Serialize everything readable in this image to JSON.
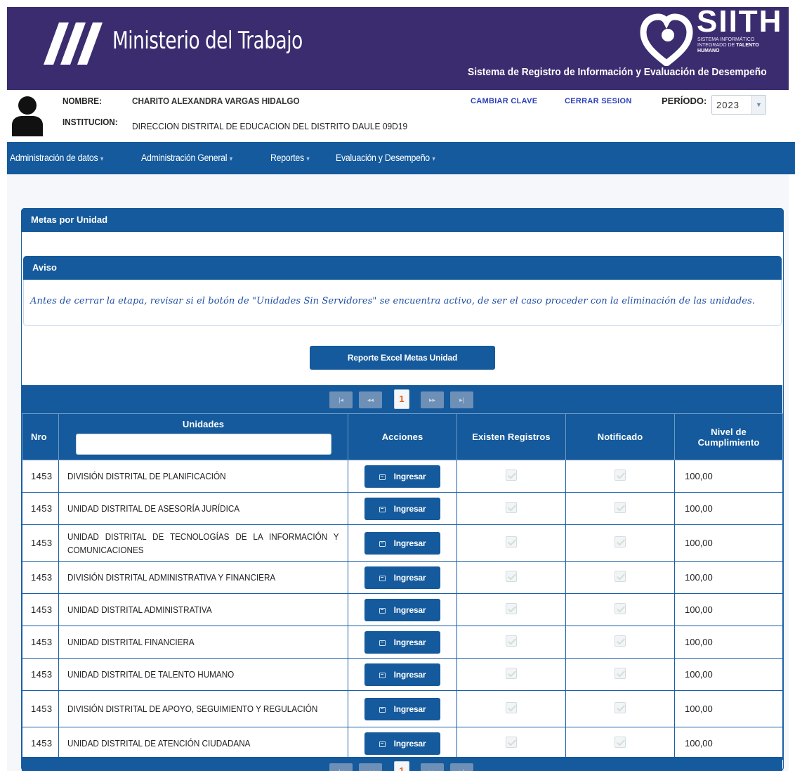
{
  "header": {
    "ministry": "Ministerio del Trabajo",
    "brand": "SIITH",
    "brand_sub_1": "SISTEMA INFORMÁTICO",
    "brand_sub_2": "INTEGRADO DE",
    "brand_sub_3": "TALENTO",
    "brand_sub_4": "HUMANO",
    "system_title": "Sistema de Registro de Información y Evaluación de Desempeño"
  },
  "user": {
    "name_label": "NOMBRE:",
    "name": "CHARITO ALEXANDRA VARGAS HIDALGO",
    "institution_label": "INSTITUCION:",
    "institution": "DIRECCION DISTRITAL DE EDUCACION DEL DISTRITO DAULE 09D19",
    "change_password": "CAMBIAR CLAVE",
    "logout": "CERRAR SESION",
    "period_label": "PERÍODO:",
    "period_value": "2023"
  },
  "nav": {
    "items": [
      {
        "label": "Administración de datos"
      },
      {
        "label": "Administración General"
      },
      {
        "label": "Reportes"
      },
      {
        "label": "Evaluación y Desempeño"
      }
    ]
  },
  "panel": {
    "title": "Metas por Unidad",
    "notice_title": "Aviso",
    "notice_text": "Antes de cerrar la etapa, revisar si el botón de \"Unidades Sin Servidores\" se encuentra activo, de ser el caso proceder con la eliminación de las unidades.",
    "report_button": "Reporte Excel Metas Unidad"
  },
  "pager": {
    "first": "|◂",
    "prev": "◂◂",
    "current": "1",
    "next": "▸▸",
    "last": "▸|"
  },
  "table": {
    "headers": {
      "nro": "Nro",
      "units": "Unidades",
      "actions": "Acciones",
      "records": "Existen Registros",
      "notified": "Notificado",
      "level_1": "Nivel de",
      "level_2": "Cumplimiento"
    },
    "filter_value": "",
    "action_label": "Ingresar",
    "rows": [
      {
        "nro": "1453",
        "unit": "DIVISIÓN DISTRITAL DE PLANIFICACIÓN",
        "level": "100,00"
      },
      {
        "nro": "1453",
        "unit": "UNIDAD DISTRITAL DE ASESORÍA JURÍDICA",
        "level": "100,00"
      },
      {
        "nro": "1453",
        "unit": "UNIDAD DISTRITAL DE TECNOLOGÍAS DE LA INFORMACIÓN Y COMUNICACIONES",
        "level": "100,00"
      },
      {
        "nro": "1453",
        "unit": "DIVISIÓN DISTRITAL ADMINISTRATIVA Y FINANCIERA",
        "level": "100,00"
      },
      {
        "nro": "1453",
        "unit": "UNIDAD DISTRITAL ADMINISTRATIVA",
        "level": "100,00"
      },
      {
        "nro": "1453",
        "unit": "UNIDAD DISTRITAL FINANCIERA",
        "level": "100,00"
      },
      {
        "nro": "1453",
        "unit": "UNIDAD DISTRITAL DE TALENTO HUMANO",
        "level": "100,00"
      },
      {
        "nro": "1453",
        "unit": "DIVISIÓN DISTRITAL DE APOYO, SEGUIMIENTO Y REGULACIÓN",
        "level": "100,00"
      },
      {
        "nro": "1453",
        "unit": "UNIDAD DISTRITAL DE ATENCIÓN CIUDADANA",
        "level": "100,00"
      }
    ]
  }
}
